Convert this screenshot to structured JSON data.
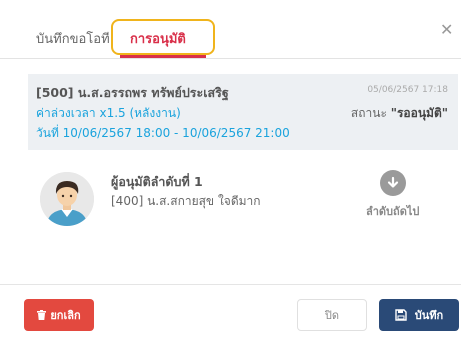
{
  "tabs": [
    {
      "label": "บันทึกขอโอที"
    },
    {
      "label": "การอนุมัติ"
    }
  ],
  "request": {
    "employee": "[500] น.ส.อรรถพร ทรัพย์ประเสริฐ",
    "created_at": "05/06/2567 17:18",
    "ot_type": "ค่าล่วงเวลา x1.5 (หลังงาน)",
    "status_label": "สถานะ",
    "status_value": "\"รออนุมัติ\"",
    "time_range": "วันที่ 10/06/2567 18:00 - 10/06/2567 21:00"
  },
  "approver": {
    "title": "ผู้อนุมัติลำดับที่ 1",
    "name": "[400] น.ส.สกายสุข ใจดีมาก",
    "next_label": "ลำดับถัดไป"
  },
  "footer": {
    "cancel_label": "ยกเลิก",
    "close_label": "ปิด",
    "save_label": "บันทึก"
  },
  "icons": {
    "close": "close-icon",
    "next": "arrow-down-circle-icon",
    "trash": "trash-icon",
    "save": "floppy-disk-icon"
  },
  "colors": {
    "accent": "#d9304a",
    "highlight": "#f0b41c",
    "link": "#1aa3dd",
    "cancel": "#e3493f",
    "save": "#2a4a77"
  }
}
